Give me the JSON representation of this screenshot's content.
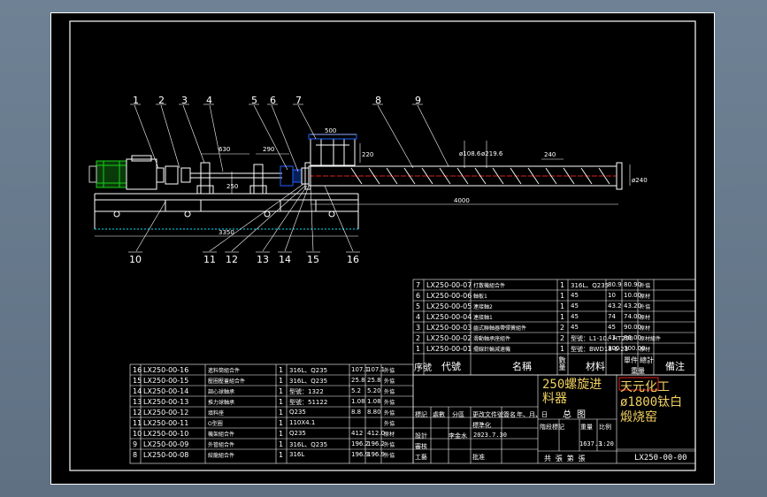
{
  "drawing": {
    "balloons": [
      "1",
      "2",
      "3",
      "4",
      "5",
      "6",
      "7",
      "8",
      "9",
      "10",
      "11",
      "12",
      "13",
      "14",
      "15",
      "16"
    ],
    "dimensions": {
      "d630": "630",
      "d290": "290",
      "d500": "500",
      "d220": "220",
      "d240_pitch": "240",
      "d240_height": "ø240",
      "d4000": "4000",
      "d3350": "3350",
      "d250": "250",
      "phi108": "ø108.6",
      "phi219": "ø219.6"
    }
  },
  "bom_right": {
    "rows": [
      {
        "no": "7",
        "code": "LX250-00-07",
        "name": "打散機組合件",
        "qty": "1",
        "mat": "316L、Q235",
        "unit": "80.9",
        "total": "80.90",
        "note": "外協"
      },
      {
        "no": "6",
        "code": "LX250-00-06",
        "name": "軸板1",
        "qty": "1",
        "mat": "45",
        "unit": "10",
        "total": "10.00",
        "note": "原材"
      },
      {
        "no": "5",
        "code": "LX250-00-05",
        "name": "連接軸2",
        "qty": "1",
        "mat": "45",
        "unit": "43.2",
        "total": "43.20",
        "note": "外協"
      },
      {
        "no": "4",
        "code": "LX250-00-04",
        "name": "連接軸1",
        "qty": "1",
        "mat": "45",
        "unit": "74",
        "total": "74.00",
        "note": "原材"
      },
      {
        "no": "3",
        "code": "LX250-00-03",
        "name": "齒式聯軸器帶彈簧組件",
        "qty": "2",
        "mat": "45",
        "unit": "45",
        "total": "90.00",
        "note": "原材"
      },
      {
        "no": "2",
        "code": "LX250-00-02",
        "name": "滑動軸承座組件",
        "qty": "2",
        "mat": "型號：L1-10、HT250",
        "unit": "43",
        "total": "86.00",
        "note": "原材組件"
      },
      {
        "no": "1",
        "code": "LX250-00-01",
        "name": "擺線針輪減速機",
        "qty": "1",
        "mat": "型號：BWD18-6-23",
        "unit": "300",
        "total": "300.00",
        "note": "原材"
      }
    ],
    "header": {
      "no": "序號",
      "code": "代號",
      "name": "名稱",
      "qty": "數量",
      "mat": "材料",
      "unit": "單件",
      "total": "總計",
      "weight": "重量",
      "note": "備注"
    }
  },
  "bom_left": {
    "rows": [
      {
        "no": "16",
        "code": "LX250-00-16",
        "name": "進料筒組合件",
        "qty": "1",
        "mat": "316L、Q235",
        "unit": "107.1",
        "total": "107.1",
        "note": "外協"
      },
      {
        "no": "15",
        "code": "LX250-00-15",
        "name": "壓圈壓蓋組合件",
        "qty": "1",
        "mat": "316L、Q235",
        "unit": "25.8",
        "total": "25.8",
        "note": "外協"
      },
      {
        "no": "14",
        "code": "LX250-00-14",
        "name": "調心球軸承",
        "qty": "1",
        "mat": "型號：1322",
        "unit": "5.2",
        "total": "5.20",
        "note": "外協"
      },
      {
        "no": "13",
        "code": "LX250-00-13",
        "name": "推力球軸承",
        "qty": "1",
        "mat": "型號：51122",
        "unit": "1.08",
        "total": "1.08",
        "note": "外協"
      },
      {
        "no": "12",
        "code": "LX250-00-12",
        "name": "填料座",
        "qty": "1",
        "mat": "Q235",
        "unit": "8.8",
        "total": "8.80",
        "note": "外協"
      },
      {
        "no": "11",
        "code": "LX250-00-11",
        "name": "O型圈",
        "qty": "1",
        "mat": "110X4.1",
        "unit": "",
        "total": "",
        "note": "外協"
      },
      {
        "no": "10",
        "code": "LX250-00-10",
        "name": "機架組合件",
        "qty": "1",
        "mat": "Q235",
        "unit": "412",
        "total": "412.0",
        "note": "原材"
      },
      {
        "no": "9",
        "code": "LX250-00-09",
        "name": "外管組合件",
        "qty": "1",
        "mat": "316L、Q235",
        "unit": "196.2",
        "total": "196.2",
        "note": "外協"
      },
      {
        "no": "8",
        "code": "LX250-00-08",
        "name": "絞龍組合件",
        "qty": "1",
        "mat": "316L",
        "unit": "196.9",
        "total": "196.9",
        "note": "外協"
      }
    ]
  },
  "title_block": {
    "product_name": "250螺旋进料器",
    "company": "天元化工ø1800钛白煅烧窑",
    "drawing_no": "LX250-00-00",
    "material": "总  图",
    "weight": "1637.3",
    "scale": "1:20",
    "scale_label": "比例",
    "weight_label": "重量",
    "stage_label": "階段標記",
    "marks": [
      "標記",
      "處數",
      "分區",
      "更改文件號",
      "簽名",
      "年、月、日"
    ],
    "design_label": "設計",
    "design_person": "李金水",
    "design_date": "2023.7.30",
    "std_label": "標準化",
    "check_label": "審核",
    "process_label": "工藝",
    "approve_label": "批准",
    "sheet_info": "共    張    第    張"
  }
}
